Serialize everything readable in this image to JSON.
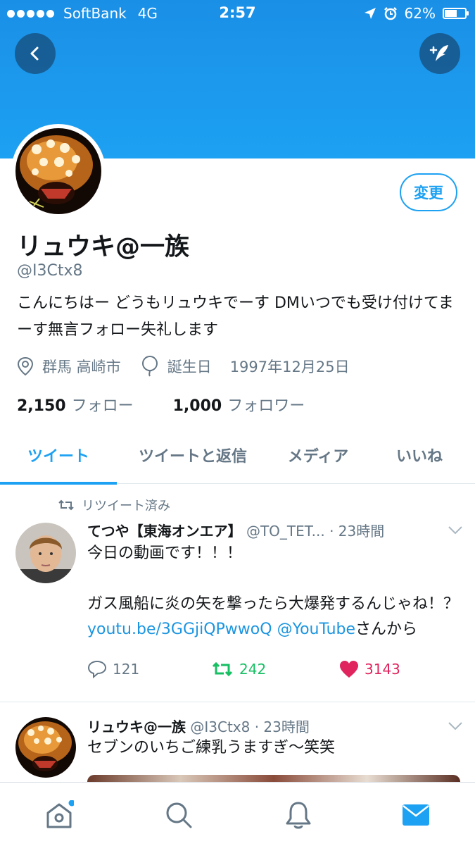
{
  "status_bar": {
    "carrier": "SoftBank",
    "network": "4G",
    "time": "2:57",
    "battery_percent": "62%",
    "battery_level": 0.62
  },
  "profile": {
    "name": "リュウキ@一族",
    "handle": "@I3Ctx8",
    "bio": "こんにちはー どうもリュウキでーす DMいつでも受け付けてまーす無言フォロー失礼します",
    "location": "群馬 高崎市",
    "birthday_label": "誕生日",
    "birthday": "1997年12月25日",
    "following_count": "2,150",
    "following_label": "フォロー",
    "followers_count": "1,000",
    "followers_label": "フォロワー",
    "edit_label": "変更"
  },
  "tabs": [
    "ツイート",
    "ツイートと返信",
    "メディア",
    "いいね"
  ],
  "tweets": [
    {
      "retweet_label": "リツイート済み",
      "name": "てつや【東海オンエア】",
      "handle": "@TO_TET...",
      "time": "· 23時間",
      "text_1": "今日の動画です！！！",
      "text_2": "ガス風船に炎の矢を撃ったら大爆発するんじゃね！？",
      "link_1": "youtu.be/3GGjiQPwwoQ",
      "link_2": "@YouTube",
      "text_3": "さんから",
      "replies": "121",
      "retweets": "242",
      "likes": "3143"
    },
    {
      "name": "リュウキ@一族",
      "handle": "@I3Ctx8",
      "time": "· 23時間",
      "text": "セブンのいちご練乳うますぎ〜笑笑"
    }
  ],
  "icons": {
    "back": "back-arrow-icon",
    "compose": "quill-compose-icon",
    "location": "location-pin-icon",
    "birthday": "balloon-icon",
    "retweet": "retweet-icon",
    "reply": "reply-icon",
    "like": "heart-icon",
    "nav": [
      "home-icon",
      "search-icon",
      "notifications-icon",
      "messages-icon"
    ]
  },
  "colors": {
    "accent": "#1da1f2",
    "retweet_green": "#17bf63",
    "like_red": "#e0245e",
    "muted": "#657786"
  }
}
